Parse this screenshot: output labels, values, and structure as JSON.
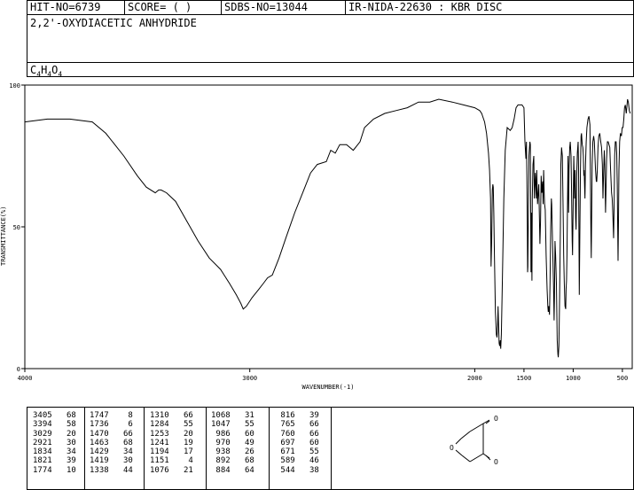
{
  "header": {
    "hit_no": "HIT-NO=6739",
    "score": "SCORE=  (   )",
    "sdbs_no": "SDBS-NO=13044",
    "ir_info": "IR-NIDA-22630 : KBR DISC"
  },
  "compound": {
    "name": "2,2'-OXYDIACETIC ANHYDRIDE",
    "formula_parts": [
      "C",
      "4",
      "H",
      "4",
      "O",
      "4"
    ]
  },
  "chart_data": {
    "type": "line",
    "xlabel": "WAVENUMBER(-1)",
    "ylabel": "TRANSMITTANCE(%)",
    "xlim": [
      4000,
      400
    ],
    "ylim": [
      0,
      100
    ],
    "x_ticks": [
      4000,
      3000,
      2000,
      1500,
      1000,
      500
    ],
    "y_ticks": [
      0,
      50,
      100
    ],
    "x_tick_labels": [
      "4000",
      "3000",
      "2000",
      "1500",
      "1000",
      "500"
    ],
    "y_tick_labels": [
      "0",
      "50",
      "100"
    ],
    "series": [
      {
        "points": [
          [
            4000,
            87
          ],
          [
            3900,
            88
          ],
          [
            3800,
            88
          ],
          [
            3700,
            87
          ],
          [
            3640,
            83
          ],
          [
            3560,
            75
          ],
          [
            3500,
            68
          ],
          [
            3460,
            64
          ],
          [
            3420,
            62
          ],
          [
            3405,
            63
          ],
          [
            3394,
            63
          ],
          [
            3370,
            62
          ],
          [
            3330,
            59
          ],
          [
            3280,
            52
          ],
          [
            3230,
            45
          ],
          [
            3180,
            39
          ],
          [
            3130,
            35
          ],
          [
            3090,
            30
          ],
          [
            3060,
            26
          ],
          [
            3040,
            23
          ],
          [
            3029,
            21
          ],
          [
            3015,
            22
          ],
          [
            2990,
            25
          ],
          [
            2960,
            28
          ],
          [
            2940,
            30
          ],
          [
            2921,
            32
          ],
          [
            2900,
            33
          ],
          [
            2870,
            39
          ],
          [
            2840,
            46
          ],
          [
            2800,
            55
          ],
          [
            2760,
            63
          ],
          [
            2730,
            69
          ],
          [
            2700,
            72
          ],
          [
            2660,
            73
          ],
          [
            2640,
            77
          ],
          [
            2620,
            76
          ],
          [
            2600,
            79
          ],
          [
            2570,
            79
          ],
          [
            2540,
            77
          ],
          [
            2510,
            80
          ],
          [
            2490,
            85
          ],
          [
            2450,
            88
          ],
          [
            2400,
            90
          ],
          [
            2350,
            91
          ],
          [
            2300,
            92
          ],
          [
            2250,
            94
          ],
          [
            2200,
            94
          ],
          [
            2160,
            95
          ],
          [
            2100,
            94
          ],
          [
            2050,
            93
          ],
          [
            2000,
            92
          ],
          [
            1950,
            91
          ],
          [
            1930,
            90
          ],
          [
            1900,
            87
          ],
          [
            1880,
            83
          ],
          [
            1860,
            76
          ],
          [
            1850,
            70
          ],
          [
            1840,
            60
          ],
          [
            1834,
            36
          ],
          [
            1828,
            45
          ],
          [
            1821,
            63
          ],
          [
            1816,
            65
          ],
          [
            1812,
            64
          ],
          [
            1806,
            55
          ],
          [
            1800,
            40
          ],
          [
            1790,
            20
          ],
          [
            1780,
            12
          ],
          [
            1774,
            11
          ],
          [
            1768,
            15
          ],
          [
            1763,
            22
          ],
          [
            1758,
            15
          ],
          [
            1752,
            9
          ],
          [
            1747,
            8
          ],
          [
            1741,
            10
          ],
          [
            1736,
            7
          ],
          [
            1730,
            12
          ],
          [
            1720,
            30
          ],
          [
            1705,
            60
          ],
          [
            1690,
            77
          ],
          [
            1670,
            85
          ],
          [
            1640,
            84
          ],
          [
            1620,
            85
          ],
          [
            1600,
            88
          ],
          [
            1580,
            92
          ],
          [
            1560,
            93
          ],
          [
            1520,
            93
          ],
          [
            1500,
            92
          ],
          [
            1490,
            80
          ],
          [
            1480,
            74
          ],
          [
            1475,
            80
          ],
          [
            1470,
            68
          ],
          [
            1466,
            50
          ],
          [
            1463,
            34
          ],
          [
            1460,
            36
          ],
          [
            1455,
            56
          ],
          [
            1450,
            75
          ],
          [
            1440,
            80
          ],
          [
            1435,
            79
          ],
          [
            1429,
            34
          ],
          [
            1424,
            55
          ],
          [
            1419,
            31
          ],
          [
            1415,
            60
          ],
          [
            1408,
            72
          ],
          [
            1400,
            75
          ],
          [
            1395,
            60
          ],
          [
            1385,
            69
          ],
          [
            1375,
            60
          ],
          [
            1370,
            70
          ],
          [
            1362,
            58
          ],
          [
            1350,
            65
          ],
          [
            1338,
            44
          ],
          [
            1332,
            52
          ],
          [
            1325,
            68
          ],
          [
            1318,
            62
          ],
          [
            1310,
            66
          ],
          [
            1305,
            58
          ],
          [
            1300,
            70
          ],
          [
            1295,
            62
          ],
          [
            1290,
            58
          ],
          [
            1284,
            56
          ],
          [
            1275,
            40
          ],
          [
            1265,
            28
          ],
          [
            1258,
            22
          ],
          [
            1253,
            20
          ],
          [
            1248,
            22
          ],
          [
            1241,
            19
          ],
          [
            1235,
            30
          ],
          [
            1228,
            50
          ],
          [
            1222,
            60
          ],
          [
            1218,
            58
          ],
          [
            1210,
            45
          ],
          [
            1200,
            30
          ],
          [
            1194,
            17
          ],
          [
            1190,
            25
          ],
          [
            1185,
            45
          ],
          [
            1178,
            40
          ],
          [
            1170,
            30
          ],
          [
            1162,
            10
          ],
          [
            1155,
            5
          ],
          [
            1151,
            4
          ],
          [
            1145,
            8
          ],
          [
            1138,
            25
          ],
          [
            1130,
            50
          ],
          [
            1125,
            72
          ],
          [
            1118,
            78
          ],
          [
            1110,
            75
          ],
          [
            1102,
            55
          ],
          [
            1096,
            40
          ],
          [
            1090,
            30
          ],
          [
            1083,
            22
          ],
          [
            1076,
            21
          ],
          [
            1072,
            28
          ],
          [
            1068,
            31
          ],
          [
            1063,
            40
          ],
          [
            1058,
            58
          ],
          [
            1052,
            75
          ],
          [
            1047,
            55
          ],
          [
            1042,
            70
          ],
          [
            1035,
            78
          ],
          [
            1030,
            80
          ],
          [
            1022,
            75
          ],
          [
            1016,
            62
          ],
          [
            1010,
            45
          ],
          [
            1006,
            40
          ],
          [
            1000,
            58
          ],
          [
            994,
            75
          ],
          [
            986,
            60
          ],
          [
            980,
            70
          ],
          [
            975,
            53
          ],
          [
            970,
            49
          ],
          [
            964,
            68
          ],
          [
            958,
            76
          ],
          [
            950,
            80
          ],
          [
            945,
            70
          ],
          [
            938,
            26
          ],
          [
            932,
            50
          ],
          [
            926,
            70
          ],
          [
            920,
            82
          ],
          [
            915,
            83
          ],
          [
            908,
            79
          ],
          [
            902,
            78
          ],
          [
            896,
            75
          ],
          [
            892,
            68
          ],
          [
            888,
            70
          ],
          [
            884,
            64
          ],
          [
            880,
            60
          ],
          [
            875,
            72
          ],
          [
            868,
            80
          ],
          [
            860,
            85
          ],
          [
            850,
            88
          ],
          [
            840,
            89
          ],
          [
            830,
            86
          ],
          [
            825,
            70
          ],
          [
            820,
            48
          ],
          [
            816,
            39
          ],
          [
            812,
            55
          ],
          [
            807,
            72
          ],
          [
            800,
            80
          ],
          [
            792,
            82
          ],
          [
            785,
            80
          ],
          [
            780,
            76
          ],
          [
            773,
            70
          ],
          [
            765,
            66
          ],
          [
            760,
            66
          ],
          [
            755,
            70
          ],
          [
            748,
            78
          ],
          [
            740,
            82
          ],
          [
            730,
            83
          ],
          [
            720,
            80
          ],
          [
            712,
            78
          ],
          [
            704,
            72
          ],
          [
            697,
            60
          ],
          [
            690,
            70
          ],
          [
            684,
            77
          ],
          [
            679,
            72
          ],
          [
            671,
            55
          ],
          [
            666,
            64
          ],
          [
            660,
            74
          ],
          [
            652,
            80
          ],
          [
            644,
            80
          ],
          [
            636,
            79
          ],
          [
            628,
            78
          ],
          [
            620,
            70
          ],
          [
            610,
            62
          ],
          [
            604,
            60
          ],
          [
            595,
            52
          ],
          [
            589,
            46
          ],
          [
            584,
            58
          ],
          [
            578,
            75
          ],
          [
            572,
            80
          ],
          [
            564,
            80
          ],
          [
            558,
            76
          ],
          [
            552,
            65
          ],
          [
            548,
            50
          ],
          [
            544,
            38
          ],
          [
            540,
            52
          ],
          [
            535,
            70
          ],
          [
            528,
            80
          ],
          [
            520,
            83
          ],
          [
            510,
            82
          ],
          [
            502,
            85
          ],
          [
            494,
            85
          ],
          [
            486,
            88
          ],
          [
            478,
            92
          ],
          [
            470,
            93
          ],
          [
            460,
            90
          ],
          [
            448,
            95
          ],
          [
            440,
            94
          ],
          [
            430,
            91
          ],
          [
            420,
            90
          ]
        ]
      }
    ]
  },
  "peak_table": {
    "columns": [
      [
        [
          "3405",
          "68"
        ],
        [
          "3394",
          "58"
        ],
        [
          "3029",
          "20"
        ],
        [
          "2921",
          "30"
        ],
        [
          "1834",
          "34"
        ],
        [
          "1821",
          "39"
        ],
        [
          "1774",
          "10"
        ]
      ],
      [
        [
          "1747",
          "8"
        ],
        [
          "1736",
          "6"
        ],
        [
          "1470",
          "66"
        ],
        [
          "1463",
          "68"
        ],
        [
          "1429",
          "34"
        ],
        [
          "1419",
          "30"
        ],
        [
          "1338",
          "44"
        ]
      ],
      [
        [
          "1310",
          "66"
        ],
        [
          "1284",
          "55"
        ],
        [
          "1253",
          "20"
        ],
        [
          "1241",
          "19"
        ],
        [
          "1194",
          "17"
        ],
        [
          "1151",
          "4"
        ],
        [
          "1076",
          "21"
        ]
      ],
      [
        [
          "1068",
          "31"
        ],
        [
          "1047",
          "55"
        ],
        [
          "986",
          "60"
        ],
        [
          "970",
          "49"
        ],
        [
          "938",
          "26"
        ],
        [
          "892",
          "68"
        ],
        [
          "884",
          "64"
        ]
      ],
      [
        [
          "816",
          "39"
        ],
        [
          "765",
          "66"
        ],
        [
          "760",
          "66"
        ],
        [
          "697",
          "60"
        ],
        [
          "671",
          "55"
        ],
        [
          "589",
          "46"
        ],
        [
          "544",
          "38"
        ]
      ]
    ]
  },
  "structure": {
    "o_top": "O",
    "o_ring": "O",
    "o_bottom": "O"
  }
}
